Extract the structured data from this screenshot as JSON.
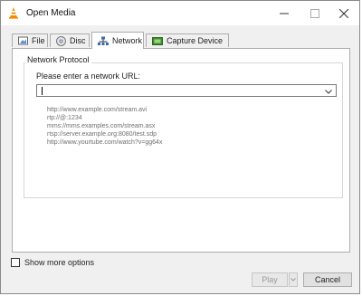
{
  "window": {
    "title": "Open Media"
  },
  "tabs": [
    {
      "label": "File",
      "icon": "file-icon"
    },
    {
      "label": "Disc",
      "icon": "disc-icon"
    },
    {
      "label": "Network",
      "icon": "network-icon",
      "active": true
    },
    {
      "label": "Capture Device",
      "icon": "capture-device-icon"
    }
  ],
  "network": {
    "group_title": "Network Protocol",
    "url_label": "Please enter a network URL:",
    "url_value": "",
    "examples": [
      "http://www.example.com/stream.avi",
      "rtp://@:1234",
      "mms://mms.examples.com/stream.asx",
      "rtsp://server.example.org:8080/test.sdp",
      "http://www.yourtube.com/watch?v=gg64x"
    ]
  },
  "footer": {
    "show_more_label": "Show more options",
    "play_label": "Play",
    "cancel_label": "Cancel"
  },
  "colors": {
    "vlc_orange": "#f08c00",
    "accent_border": "#adadad"
  }
}
